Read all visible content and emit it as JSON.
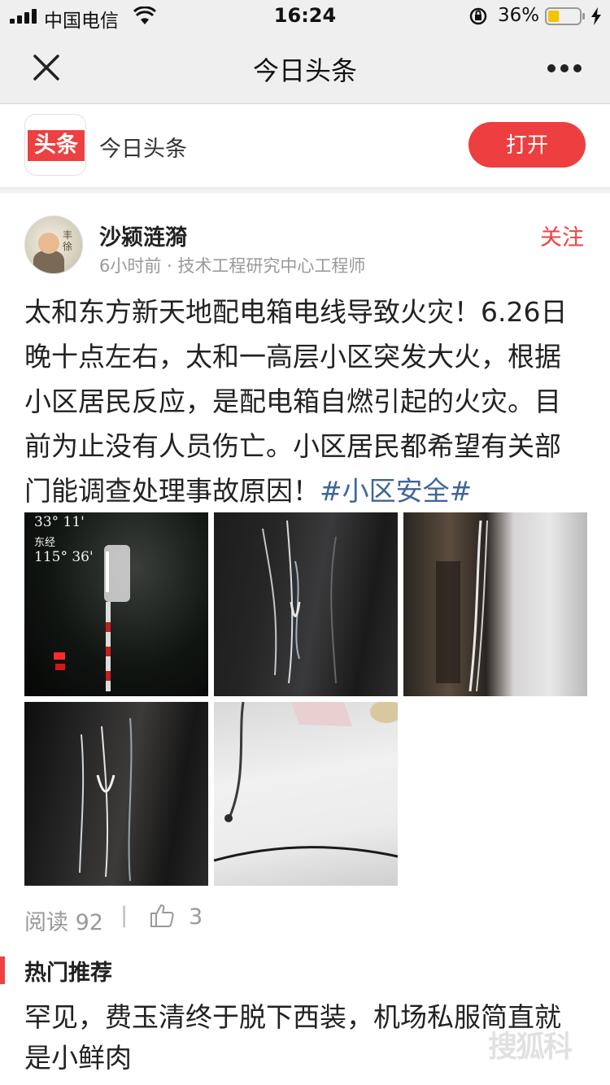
{
  "status_bar": {
    "carrier": "中国电信",
    "time": "16:24",
    "battery_percent": "36%",
    "battery_level": 0.36
  },
  "navbar": {
    "title": "今日头条",
    "close_icon": "close-icon",
    "more_icon": "more-icon"
  },
  "banner": {
    "logo_text": "头条",
    "app_name": "今日头条",
    "open_label": "打开",
    "brand_color": "#ED3F3F"
  },
  "author": {
    "name": "沙颍涟漪",
    "meta": "6小时前 · 技术工程研究中心工程师",
    "follow_label": "关注",
    "avatar_text": "丰\n徐"
  },
  "article": {
    "body": "太和东方新天地配电箱电线导致火灾！6.26日晚十点左右，太和一高层小区突发大火，根据小区居民反应，是配电箱自燃引起的火灾。目前为止没有人员伤亡。小区居民都希望有关部门能调查处理事故原因！",
    "hashtag": "#小区安全#",
    "hashtag_color": "#406599"
  },
  "images": {
    "photo1_overlay": {
      "lat": "33°  11'",
      "lon_label": "东经",
      "lon": "115°  36'"
    }
  },
  "stats": {
    "read_label": "阅读 92",
    "separator": "|",
    "like_count": "3"
  },
  "hot": {
    "section_title": "热门推荐",
    "item_title": "罕见，费玉清终于脱下西装，机场私服简直就是小鲜肉",
    "watermark": "搜狐科"
  }
}
